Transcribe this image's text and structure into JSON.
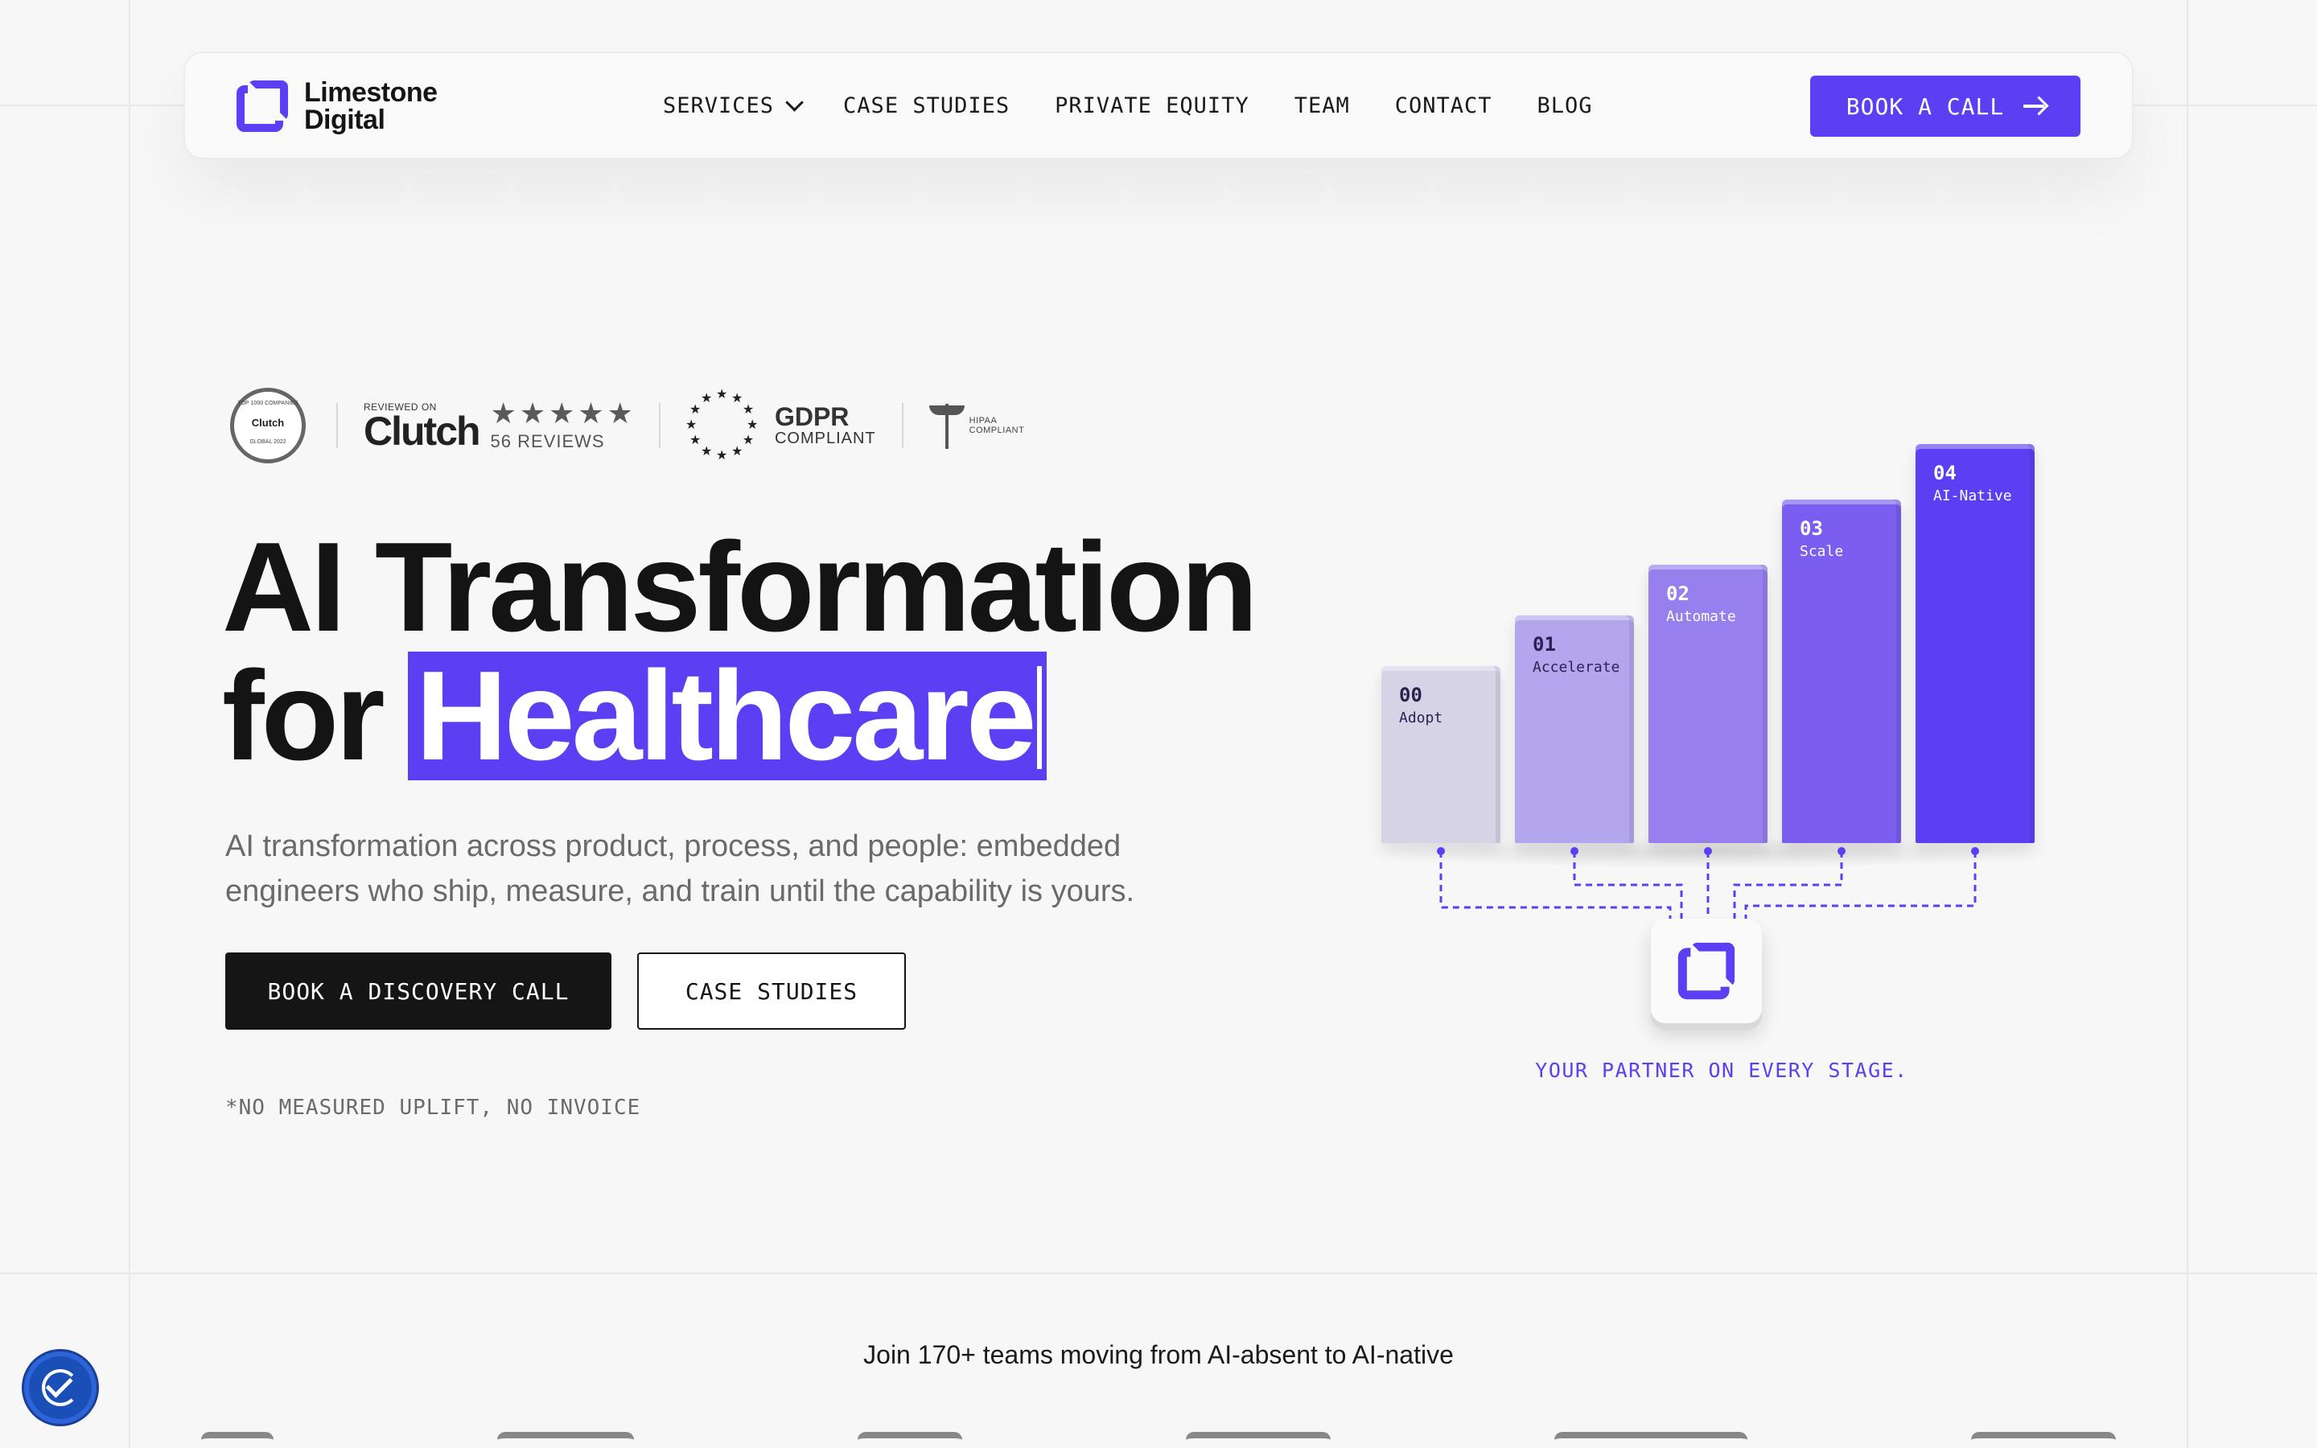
{
  "nav": {
    "logo_text_1": "Limestone",
    "logo_text_2": "Digital",
    "links": [
      {
        "label": "SERVICES",
        "has_dropdown": true
      },
      {
        "label": "CASE STUDIES"
      },
      {
        "label": "PRIVATE EQUITY"
      },
      {
        "label": "TEAM"
      },
      {
        "label": "CONTACT"
      },
      {
        "label": "BLOG"
      }
    ],
    "cta_label": "BOOK A CALL"
  },
  "badges": {
    "clutch_seal_top": "TOP 1000 COMPANIES",
    "clutch_seal_name": "Clutch",
    "clutch_seal_bottom": "GLOBAL 2022",
    "reviewed_on": "REVIEWED ON",
    "clutch": "Clutch",
    "rating": 5,
    "reviews": "56 REVIEWS",
    "gdpr_title": "GDPR",
    "gdpr_sub": "COMPLIANT",
    "hipaa_1": "HIPAA",
    "hipaa_2": "COMPLIANT"
  },
  "hero": {
    "title_line1": "AI Transformation",
    "title_for": "for",
    "title_highlight": "Healthcare",
    "subtitle": "AI transformation across product, process, and people: embedded engineers who ship, measure, and train until the capability is yours.",
    "primary_cta": "BOOK A DISCOVERY CALL",
    "secondary_cta": "CASE STUDIES",
    "footnote": "*NO MEASURED UPLIFT, NO INVOICE"
  },
  "stages": {
    "items": [
      {
        "num": "00",
        "label": "Adopt",
        "level": 1,
        "color": "#d6d3e6"
      },
      {
        "num": "01",
        "label": "Accelerate",
        "level": 2,
        "color": "#b3a6ee"
      },
      {
        "num": "02",
        "label": "Automate",
        "level": 3,
        "color": "#9680ee"
      },
      {
        "num": "03",
        "label": "Scale",
        "level": 4,
        "color": "#7a5ef0"
      },
      {
        "num": "04",
        "label": "AI-Native",
        "level": 5,
        "color": "#5c3ff2"
      }
    ],
    "partner_text": "YOUR PARTNER ON EVERY STAGE."
  },
  "social_proof": {
    "join_text": "Join 170+ teams moving from AI-absent to AI-native"
  },
  "colors": {
    "accent": "#5c3ff2",
    "dark": "#151515",
    "background": "#f7f7f7"
  },
  "icons": [
    "chevron-down-icon",
    "arrow-right-icon",
    "star-icon",
    "accessibility-icon"
  ]
}
